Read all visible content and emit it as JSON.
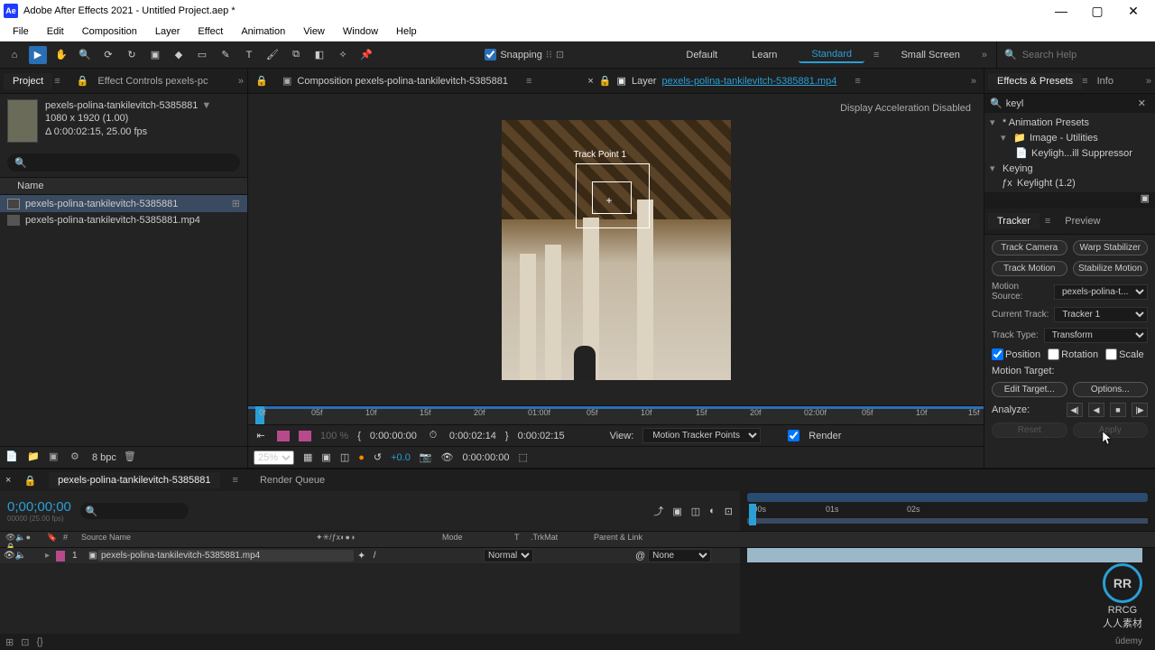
{
  "titlebar": {
    "app_icon": "Ae",
    "title": "Adobe After Effects 2021 - Untitled Project.aep *"
  },
  "menubar": {
    "items": [
      "File",
      "Edit",
      "Composition",
      "Layer",
      "Effect",
      "Animation",
      "View",
      "Window",
      "Help"
    ]
  },
  "toolbar": {
    "snapping_label": "Snapping",
    "workspaces": [
      "Default",
      "Learn",
      "Standard",
      "Small Screen"
    ],
    "active_workspace": 2,
    "search_placeholder": "Search Help"
  },
  "project_panel": {
    "tabs": {
      "project": "Project",
      "effect_controls": "Effect Controls  pexels-pc"
    },
    "selected_name": "pexels-polina-tankilevitch-5385881",
    "meta_line1": "1080 x 1920 (1.00)",
    "meta_line2": "Δ 0:00:02:15, 25.00 fps",
    "list_header": "Name",
    "items": [
      {
        "name": "pexels-polina-tankilevitch-5385881",
        "type": "comp",
        "selected": true
      },
      {
        "name": "pexels-polina-tankilevitch-5385881.mp4",
        "type": "footage",
        "selected": false
      }
    ],
    "bpc": "8 bpc"
  },
  "center": {
    "comp_tab": "Composition pexels-polina-tankilevitch-5385881",
    "layer_tab_prefix": "Layer",
    "layer_tab_link": "pexels-polina-tankilevitch-5385881.mp4",
    "accel_msg": "Display Acceleration Disabled",
    "track_point_label": "Track Point 1",
    "ruler_ticks": [
      "0f",
      "05f",
      "10f",
      "15f",
      "20f",
      "01:00f",
      "05f",
      "10f",
      "15f",
      "20f",
      "02:00f",
      "05f",
      "10f",
      "15f"
    ],
    "row1": {
      "in_time": "0:00:00:00",
      "current": "0:00:02:14",
      "duration": "0:00:02:15",
      "view_label": "View:",
      "view_value": "Motion Tracker Points",
      "render_label": "Render",
      "mag": "100 %"
    },
    "row2": {
      "zoom": "25%",
      "exposure": "+0.0",
      "time": "0:00:00:00"
    }
  },
  "effects_presets": {
    "tab": "Effects & Presets",
    "info_tab": "Info",
    "search_value": "keyl",
    "rows": [
      {
        "indent": 0,
        "twisty": "▾",
        "label": "* Animation Presets"
      },
      {
        "indent": 1,
        "twisty": "▾",
        "icon": "folder",
        "label": "Image - Utilities"
      },
      {
        "indent": 2,
        "twisty": "",
        "icon": "preset",
        "label": "Keyligh...ill Suppressor"
      },
      {
        "indent": 0,
        "twisty": "▾",
        "label": "Keying"
      },
      {
        "indent": 1,
        "twisty": "",
        "icon": "fx",
        "label": "Keylight (1.2)"
      }
    ]
  },
  "tracker": {
    "tab": "Tracker",
    "preview_tab": "Preview",
    "track_camera": "Track Camera",
    "warp_stab": "Warp Stabilizer",
    "track_motion": "Track Motion",
    "stab_motion": "Stabilize Motion",
    "motion_source_label": "Motion Source:",
    "motion_source_value": "pexels-polina-t...",
    "current_track_label": "Current Track:",
    "current_track_value": "Tracker 1",
    "track_type_label": "Track Type:",
    "track_type_value": "Transform",
    "position": "Position",
    "rotation": "Rotation",
    "scale": "Scale",
    "motion_target_label": "Motion Target:",
    "edit_target": "Edit Target...",
    "options": "Options...",
    "analyze_label": "Analyze:",
    "reset": "Reset",
    "apply": "Apply"
  },
  "timeline": {
    "comp_tab": "pexels-polina-tankilevitch-5385881",
    "render_queue": "Render Queue",
    "timecode": "0;00;00;00",
    "timecode_sub": "00000 (25.00 fps)",
    "ruler": [
      ":00s",
      "01s",
      "02s"
    ],
    "headers": {
      "eyes": "",
      "num": "#",
      "source": "Source Name",
      "mode": "Mode",
      "t": "T",
      "trkmat": ".TrkMat",
      "parent": "Parent & Link"
    },
    "layer": {
      "num": "1",
      "name": "pexels-polina-tankilevitch-5385881.mp4",
      "mode": "Normal",
      "parent": "None"
    }
  },
  "watermark": {
    "ring": "RR",
    "text": "RRCG\n人人素材",
    "udemy": "ûdemy"
  }
}
